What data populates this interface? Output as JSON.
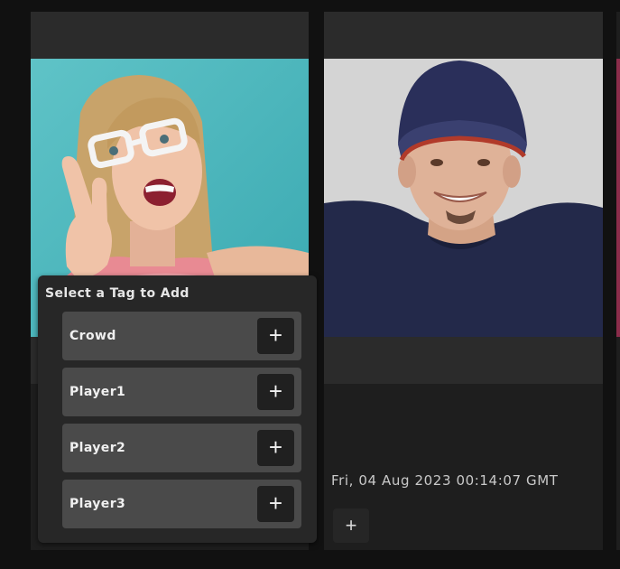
{
  "cards": [
    {
      "photo": "selfie-woman-photo"
    },
    {
      "photo": "man-beanie-photo",
      "timestamp": "Fri, 04 Aug 2023 00:14:07 GMT",
      "add_icon": "plus-icon"
    }
  ],
  "tag_popover": {
    "title": "Select a Tag to Add",
    "tags": [
      {
        "label": "Crowd",
        "icon": "plus-icon"
      },
      {
        "label": "Player1",
        "icon": "plus-icon"
      },
      {
        "label": "Player2",
        "icon": "plus-icon"
      },
      {
        "label": "Player3",
        "icon": "plus-icon"
      }
    ]
  },
  "colors": {
    "background": "#111111",
    "card": "#1e1e1e",
    "card_bar": "#2b2b2b",
    "popover": "#272727",
    "tag_row": "#4a4a4a",
    "tag_button": "#202020",
    "text": "#f0f0f0"
  }
}
